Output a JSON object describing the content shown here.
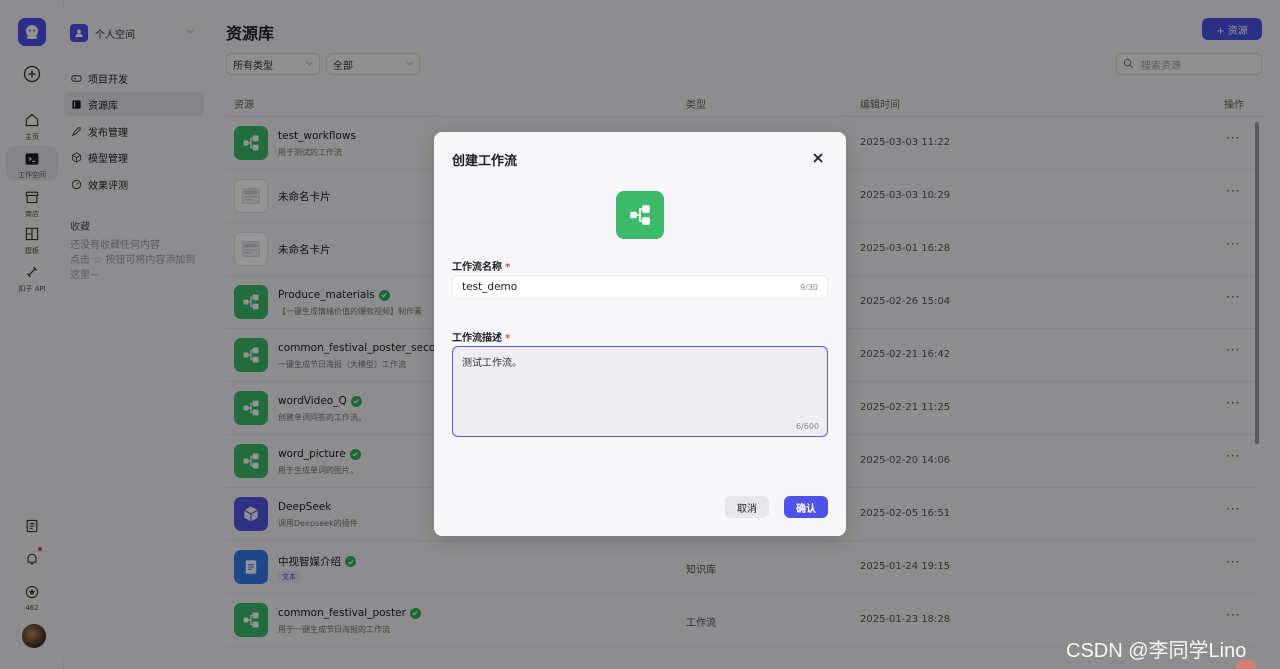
{
  "rail": {
    "items": [
      {
        "label": "主页",
        "icon": "home-icon"
      },
      {
        "label": "工作空间",
        "icon": "terminal-icon"
      },
      {
        "label": "商店",
        "icon": "store-icon"
      },
      {
        "label": "模板",
        "icon": "template-icon"
      },
      {
        "label": "扣子 API",
        "icon": "api-icon"
      }
    ],
    "points": "462"
  },
  "sidebar": {
    "space_name": "个人空间",
    "nav": [
      {
        "label": "项目开发",
        "icon": "gamepad-icon"
      },
      {
        "label": "资源库",
        "icon": "library-icon"
      },
      {
        "label": "发布管理",
        "icon": "rocket-icon"
      },
      {
        "label": "模型管理",
        "icon": "cube-icon"
      },
      {
        "label": "效果评测",
        "icon": "gauge-icon"
      }
    ],
    "fav_title": "收藏",
    "fav_empty_1": "还没有收藏任何内容",
    "fav_empty_2": "点击 ☆ 按钮可将内容添加到这里~"
  },
  "main": {
    "title": "资源库",
    "add_label": "+ 资源",
    "filter_type": "所有类型",
    "filter_scope": "全部",
    "search_placeholder": "搜索资源",
    "columns": {
      "resource": "资源",
      "type": "类型",
      "edited": "编辑时间",
      "action": "操作"
    },
    "rows": [
      {
        "icon": "wf",
        "name": "test_workflows",
        "desc": "用于测试的工作流",
        "type": "",
        "time": "2025-03-03 11:22",
        "verified": false
      },
      {
        "icon": "card",
        "name": "未命名卡片",
        "desc": "",
        "type": "",
        "time": "2025-03-03 10:29",
        "verified": false
      },
      {
        "icon": "card",
        "name": "未命名卡片",
        "desc": "",
        "type": "",
        "time": "2025-03-01 16:28",
        "verified": false
      },
      {
        "icon": "wf",
        "name": "Produce_materials",
        "desc": "【一键生成情绪价值的爆款视频】制作素",
        "type": "",
        "time": "2025-02-26 15:04",
        "verified": true
      },
      {
        "icon": "wf",
        "name": "common_festival_poster_second",
        "desc": "一键生成节日海报（大模型）工作流",
        "type": "",
        "time": "2025-02-21 16:42",
        "verified": false
      },
      {
        "icon": "wf",
        "name": "wordVideo_Q",
        "desc": "创建单词问答的工作流。",
        "type": "",
        "time": "2025-02-21 11:25",
        "verified": true
      },
      {
        "icon": "wf",
        "name": "word_picture",
        "desc": "用于生成单词的图片。",
        "type": "",
        "time": "2025-02-20 14:06",
        "verified": true
      },
      {
        "icon": "plugin",
        "name": "DeepSeek",
        "desc": "调用Deepseek的插件",
        "type": "",
        "time": "2025-02-05 16:51",
        "verified": false
      },
      {
        "icon": "kb",
        "name": "中视智媒介绍",
        "tag": "文本",
        "type": "知识库",
        "time": "2025-01-24 19:15",
        "verified": true
      },
      {
        "icon": "wf",
        "name": "common_festival_poster",
        "desc": "用于一键生成节日海报的工作流",
        "type": "工作流",
        "time": "2025-01-23 18:28",
        "verified": true
      }
    ]
  },
  "modal": {
    "title": "创建工作流",
    "name_label": "工作流名称",
    "name_value": "test_demo",
    "name_count": "9/30",
    "desc_label": "工作流描述",
    "desc_value": "测试工作流。",
    "desc_count": "6/600",
    "cancel": "取消",
    "confirm": "确认"
  },
  "watermark": "CSDN @李同学Lino",
  "colors": {
    "accent": "#4d53e8",
    "workflow": "#3cba6a",
    "verified": "#2db55d",
    "required": "#f53f3f"
  }
}
